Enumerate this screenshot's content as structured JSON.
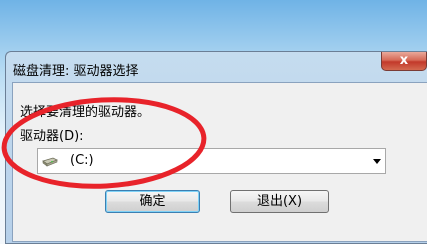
{
  "dialog": {
    "title": "磁盘清理: 驱动器选择",
    "close_label": "x",
    "prompt": "选择要清理的驱动器。",
    "drive_label": "驱动器(D):",
    "drive_select": {
      "value": "(C:)",
      "icon": "hard-drive-icon"
    },
    "ok_label": "确定",
    "exit_label": "退出(X)"
  },
  "colors": {
    "annotation_circle": "#e8232a",
    "close_button": "#c2392a",
    "default_button_border": "#3c7fb1"
  }
}
